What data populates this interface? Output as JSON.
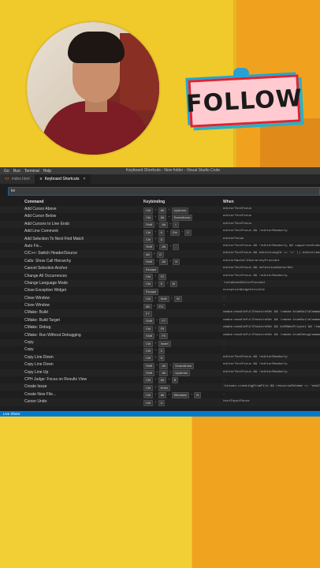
{
  "window": {
    "menu": [
      "Go",
      "Run",
      "Terminal",
      "Help"
    ],
    "title": "Keyboard Shortcuts - New folder - Visual Studio Code"
  },
  "tabs": [
    {
      "label": "index.html",
      "icon": "html-file-icon",
      "active": false
    },
    {
      "label": "Keyboard Shortcuts",
      "icon": "keyboard-icon",
      "active": true
    }
  ],
  "search": {
    "value": "ke"
  },
  "columns": {
    "command": "Command",
    "keybinding": "Keybinding",
    "when": "When"
  },
  "rows": [
    {
      "command": "Add Cursor Above",
      "keys": [
        "Ctrl",
        "Alt",
        "UpArrow"
      ],
      "when": "editorTextFocus"
    },
    {
      "command": "Add Cursor Below",
      "keys": [
        "Ctrl",
        "Alt",
        "DownArrow"
      ],
      "when": "editorTextFocus"
    },
    {
      "command": "Add Cursors to Line Ends",
      "keys": [
        "Shift",
        "Alt",
        "I"
      ],
      "when": "editorTextFocus"
    },
    {
      "command": "Add Line Comment",
      "keys": [
        "Ctrl",
        "K",
        "Ctrl",
        "C"
      ],
      "when": "editorTextFocus && !editorReadonly"
    },
    {
      "command": "Add Selection To Next Find Match",
      "keys": [
        "Ctrl",
        "D"
      ],
      "when": "editorFocus"
    },
    {
      "command": "Auto Fix...",
      "keys": [
        "Shift",
        "Alt",
        "."
      ],
      "when": "editorTextFocus && !editorReadonly && supportedCodeAction"
    },
    {
      "command": "C/C++: Switch Header/Source",
      "keys": [
        "Alt",
        "O"
      ],
      "when": "editorTextFocus && editorLangId == 'c' || editorLangId"
    },
    {
      "command": "Calls: Show Call Hierarchy",
      "keys": [
        "Shift",
        "Alt",
        "H"
      ],
      "when": "editorHasCallHierarchyProvider"
    },
    {
      "command": "Cancel Selection Anchor",
      "keys": [
        "Escape"
      ],
      "when": "editorTextFocus && selectionAnchorSet"
    },
    {
      "command": "Change All Occurrences",
      "keys": [
        "Ctrl",
        "F2"
      ],
      "when": "editorTextFocus && !editorReadonly"
    },
    {
      "command": "Change Language Mode",
      "keys": [
        "Ctrl",
        "K",
        "M"
      ],
      "when": "!notebookEditorFocused"
    },
    {
      "command": "Close Exception Widget",
      "keys": [
        "Escape"
      ],
      "when": "exceptionWidgetVisible"
    },
    {
      "command": "Close Window",
      "keys": [
        "Ctrl",
        "Shift",
        "W"
      ],
      "when": "-"
    },
    {
      "command": "Close Window",
      "keys": [
        "Alt",
        "F4"
      ],
      "when": "-"
    },
    {
      "command": "CMake: Build",
      "keys": [
        "F7"
      ],
      "when": "cmake:enableFullFeatureSet && !cmake:hideBuildCommand"
    },
    {
      "command": "CMake: Build Target",
      "keys": [
        "Shift",
        "F7"
      ],
      "when": "cmake:enableFullFeatureSet && !cmake:hideBuildCommand"
    },
    {
      "command": "CMake: Debug",
      "keys": [
        "Ctrl",
        "F5"
      ],
      "when": "cmake:enableFullFeatureSet && inCMakeProject && !cmake"
    },
    {
      "command": "CMake: Run Without Debugging",
      "keys": [
        "Shift",
        "F5"
      ],
      "when": "cmake:enableFullFeatureSet && !cmake:hideDebugCommand"
    },
    {
      "command": "Copy",
      "keys": [
        "Ctrl",
        "Insert"
      ],
      "when": "-"
    },
    {
      "command": "Copy",
      "keys": [
        "Ctrl",
        "C"
      ],
      "when": "-"
    },
    {
      "command": "Copy Line Down",
      "keys": [
        "Ctrl",
        "D"
      ],
      "when": "editorTextFocus && !editorReadonly"
    },
    {
      "command": "Copy Line Down",
      "keys": [
        "Shift",
        "Alt",
        "DownArrow"
      ],
      "when": "editorTextFocus && !editorReadonly"
    },
    {
      "command": "Copy Line Up",
      "keys": [
        "Shift",
        "Alt",
        "UpArrow"
      ],
      "when": "editorTextFocus && !editorReadonly"
    },
    {
      "command": "CPH Judge: Focus on Results View",
      "keys": [
        "Ctrl",
        "Alt",
        "B"
      ],
      "when": "-"
    },
    {
      "command": "Create Issue",
      "keys": [
        "Ctrl",
        "Enter"
      ],
      "when": "!issues.creatingFromFile && resourceScheme == 'newIssue'"
    },
    {
      "command": "Create New File...",
      "keys": [
        "Ctrl",
        "Alt",
        "Windows",
        "N"
      ],
      "when": "-"
    },
    {
      "command": "Cursor Undo",
      "keys": [
        "Ctrl",
        "U"
      ],
      "when": "textInputFocus"
    }
  ],
  "status": {
    "live_share": "Live Share"
  },
  "overlay": {
    "follow": "FOLLOW"
  }
}
